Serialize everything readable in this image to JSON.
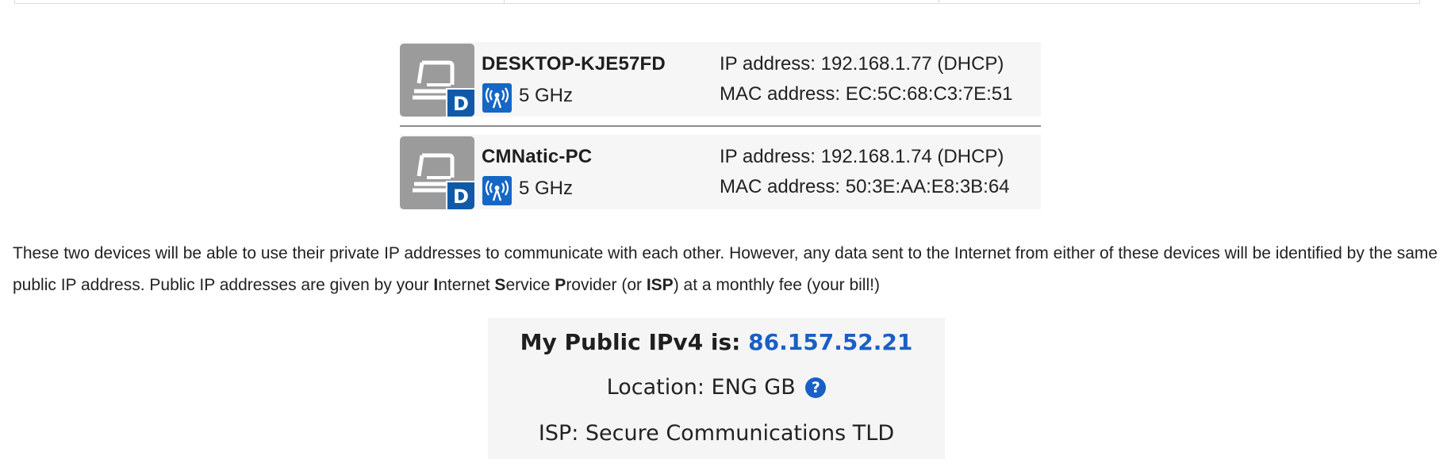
{
  "devices": [
    {
      "name": "DESKTOP-KJE57FD",
      "badge": "D",
      "band": "5 GHz",
      "ip": "IP address: 192.168.1.77 (DHCP)",
      "mac": "MAC address: EC:5C:68:C3:7E:51",
      "icon": "laptop-icon"
    },
    {
      "name": "CMNatic-PC",
      "badge": "D",
      "band": "5 GHz",
      "ip": "IP address: 192.168.1.74 (DHCP)",
      "mac": "MAC address: 50:3E:AA:E8:3B:64",
      "icon": "laptop-icon"
    }
  ],
  "paragraph": {
    "part1": "These two devices will be able to use their private IP addresses to communicate with each other. However, any data sent to the Internet from either of these devices will be identified by the same public IP address. Public IP addresses are given by your ",
    "i_letter": "I",
    "i_rest": "nternet ",
    "s_letter": "S",
    "s_rest": "ervice ",
    "p_letter": "P",
    "p_rest": "rovider (or ",
    "isp": "ISP",
    "part_end": ") at a monthly fee (your bill!)"
  },
  "public_ip": {
    "label": "My Public IPv4 is: ",
    "value": "86.157.52.21",
    "location": "Location: ENG GB",
    "help_glyph": "?",
    "isp": "ISP: Secure Communications TLD"
  },
  "colors": {
    "accent": "#1a5fc4",
    "badge": "#0f5aa8",
    "wifi": "#1567c5",
    "icon_bg": "#9b9b9b"
  }
}
